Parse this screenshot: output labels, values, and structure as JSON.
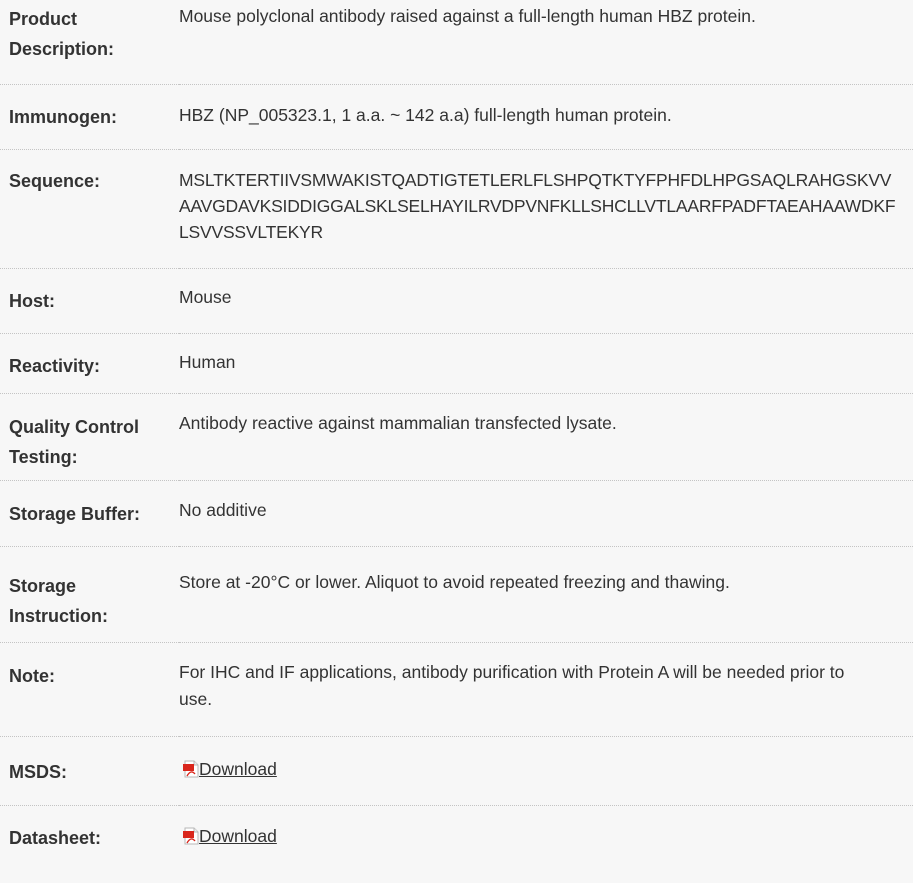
{
  "rows": [
    {
      "label": "Product Description:",
      "value": "Mouse polyclonal antibody raised against a full-length human HBZ protein."
    },
    {
      "label": "Immunogen:",
      "value": "HBZ (NP_005323.1, 1 a.a. ~ 142 a.a) full-length human protein."
    },
    {
      "label": "Sequence:",
      "value": "MSLTKTERTIIVSMWAKISTQADTIGTETLERLFLSHPQTKTYFPHFDLHPGSAQLRAHGSKVVAAVGDAVKSIDDIGGALSKLSELHAYILRVDPVNFKLLSHCLLVTLAARFPADFTAEAHAAWDKFLSVVSSVLTEKYR"
    },
    {
      "label": "Host:",
      "value": "Mouse"
    },
    {
      "label": "Reactivity:",
      "value": "Human"
    },
    {
      "label": "Quality Control Testing:",
      "value": "Antibody reactive against mammalian transfected lysate."
    },
    {
      "label": "Storage Buffer:",
      "value": "No additive"
    },
    {
      "label": "Storage Instruction:",
      "value": "Store at -20°C or lower. Aliquot to avoid repeated freezing and thawing."
    },
    {
      "label": "Note:",
      "value": "For IHC and IF applications, antibody purification with Protein A will be needed prior to use."
    },
    {
      "label": "MSDS:",
      "link_text": "Download",
      "icon": "pdf-icon"
    },
    {
      "label": "Datasheet:",
      "link_text": "Download",
      "icon": "pdf-icon"
    }
  ],
  "colors": {
    "background": "#f7f7f7",
    "text": "#333333",
    "divider": "#c4c4c4",
    "pdf_red": "#d9261c"
  }
}
